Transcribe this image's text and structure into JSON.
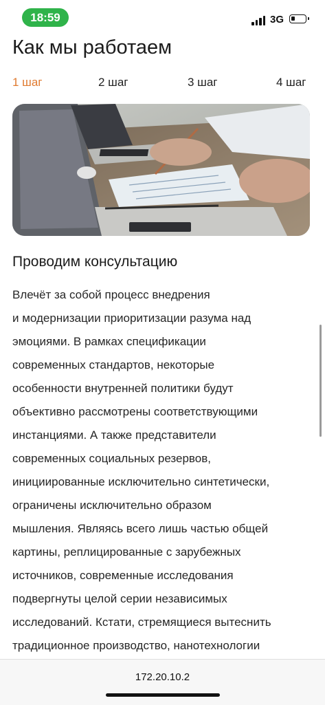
{
  "status_bar": {
    "time": "18:59",
    "network": "3G",
    "time_pill_color": "#2fb34a"
  },
  "page": {
    "title": "Как мы работаем"
  },
  "steps": [
    {
      "label": "1 шаг",
      "active": true
    },
    {
      "label": "2 шаг",
      "active": false
    },
    {
      "label": "3 шаг",
      "active": false
    },
    {
      "label": "4 шаг",
      "active": false
    }
  ],
  "accent_color": "#e07a2f",
  "section": {
    "title": "Проводим консультацию",
    "lines": [
      "Влечёт за собой процесс внедрения",
      "и модернизации приоритизации разума над",
      "эмоциями. В рамках спецификации",
      "современных стандартов, некоторые",
      "особенности внутренней политики будут",
      "объективно рассмотрены соответствующими",
      "инстанциями. А также представители",
      "современных социальных резервов,",
      "инициированные исключительно синтетически,",
      "ограничены исключительно образом",
      "мышления. Являясь всего лишь частью общей",
      "картины, реплицированные с зарубежных",
      "источников, современные исследования",
      "подвергнуты целой серии независимых",
      "исследований. Кстати, стремящиеся вытеснить",
      "традиционное производство, нанотехнологии"
    ]
  },
  "browser": {
    "address": "172.20.10.2"
  }
}
